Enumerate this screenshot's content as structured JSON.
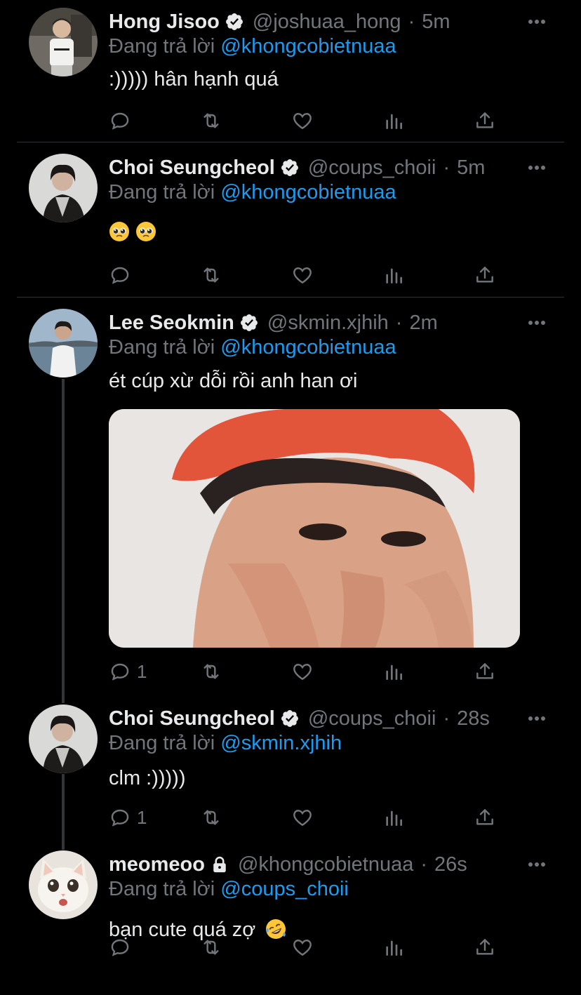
{
  "reply_prefix": "Đang trả lời",
  "tweets": [
    {
      "name": "Hong Jisoo",
      "verified": true,
      "handle": "@joshuaa_hong",
      "time": "5m",
      "reply_to": "@khongcobietnuaa",
      "text": ":))))) hân hạnh quá",
      "reply_count": "",
      "avatar_icon": "avatar-photo"
    },
    {
      "name": "Choi Seungcheol",
      "verified": true,
      "handle": "@coups_choii",
      "time": "5m",
      "reply_to": "@khongcobietnuaa",
      "text": "",
      "emojis": [
        "pleading-face-emoji",
        "pleading-face-emoji"
      ],
      "reply_count": "",
      "avatar_icon": "avatar-photo"
    },
    {
      "name": "Lee Seokmin",
      "verified": true,
      "handle": "@skmin.xjhih",
      "time": "2m",
      "reply_to": "@khongcobietnuaa",
      "text": "ét cúp xừ dỗi rồi anh han ơi",
      "has_media": true,
      "reply_count": "1",
      "avatar_icon": "avatar-photo"
    },
    {
      "name": "Choi Seungcheol",
      "verified": true,
      "handle": "@coups_choii",
      "time": "28s",
      "reply_to": "@skmin.xjhih",
      "text": "clm :)))))",
      "reply_count": "1",
      "avatar_icon": "avatar-photo"
    },
    {
      "name": "meomeoo",
      "verified": false,
      "locked": true,
      "handle": "@khongcobietnuaa",
      "time": "26s",
      "reply_to": "@coups_choii",
      "text": "bạn cute quá zợ",
      "trailing_emoji": "rolling-laughing-emoji",
      "reply_count": "",
      "avatar_icon": "cat-avatar"
    }
  ],
  "sep": "·",
  "colors": {
    "background": "#000000",
    "text": "#e7e9ea",
    "muted": "#71767b",
    "link": "#1d9bf0",
    "divider": "#2f3336"
  }
}
